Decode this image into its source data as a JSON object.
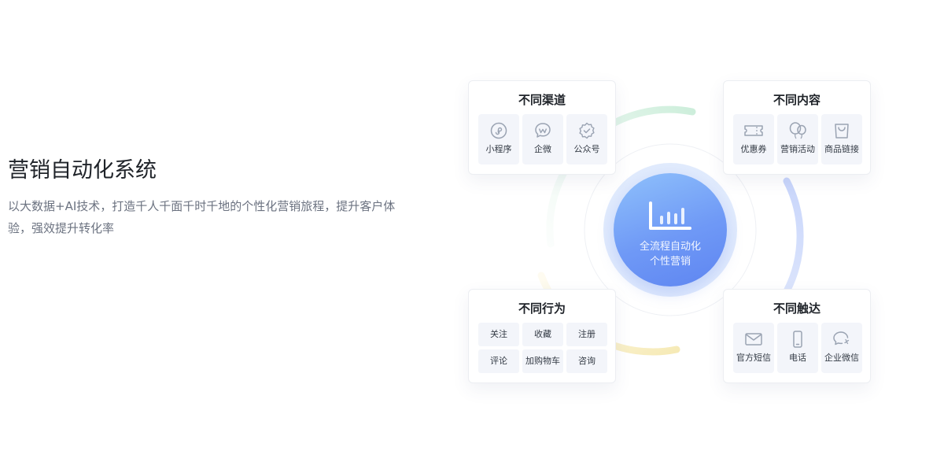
{
  "intro": {
    "title": "营销自动化系统",
    "desc": "以大数据+AI技术，打造千人千面千时千地的个性化营销旅程，提升客户体验，强效提升转化率"
  },
  "center": {
    "line1": "全流程自动化",
    "line2": "个性营销",
    "icon": "bar-chart-icon"
  },
  "cards": {
    "channels": {
      "title": "不同渠道",
      "items": [
        {
          "label": "小程序",
          "icon": "mini-program-icon"
        },
        {
          "label": "企微",
          "icon": "wecom-icon"
        },
        {
          "label": "公众号",
          "icon": "official-account-icon"
        }
      ]
    },
    "content": {
      "title": "不同内容",
      "items": [
        {
          "label": "优惠券",
          "icon": "coupon-icon"
        },
        {
          "label": "营销活动",
          "icon": "balloon-icon"
        },
        {
          "label": "商品链接",
          "icon": "shopping-bag-icon"
        }
      ]
    },
    "behavior": {
      "title": "不同行为",
      "items": [
        "关注",
        "收藏",
        "注册",
        "评论",
        "加购物车",
        "咨询"
      ]
    },
    "reach": {
      "title": "不同触达",
      "items": [
        {
          "label": "官方短信",
          "icon": "mail-icon"
        },
        {
          "label": "电话",
          "icon": "phone-icon"
        },
        {
          "label": "企业微信",
          "icon": "wechat-work-icon"
        }
      ]
    }
  },
  "colors": {
    "accent": "#6f99f6",
    "ring_blue": "#c9d6fb",
    "ring_green": "#d6f2e0",
    "ring_yellow": "#f9efc2",
    "icon_gray": "#9aa3b2"
  }
}
